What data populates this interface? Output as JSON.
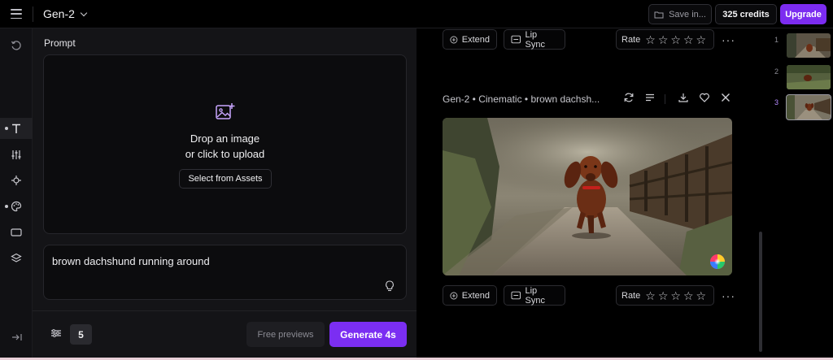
{
  "header": {
    "model": "Gen-2",
    "save_label": "Save in...",
    "credits_label": "325 credits",
    "upgrade_label": "Upgrade"
  },
  "prompt": {
    "label": "Prompt",
    "drop_line1": "Drop an image",
    "drop_line2": "or click to upload",
    "assets_button": "Select from Assets",
    "text": "brown dachshund running around"
  },
  "footer": {
    "count": "5",
    "free_previews": "Free previews",
    "generate": "Generate 4s"
  },
  "output": {
    "extend_label": "Extend",
    "lipsync_label": "Lip Sync",
    "rate_label": "Rate",
    "more_label": "···",
    "generation_title": "Gen-2 • Cinematic • brown dachsh..."
  },
  "thumbnails": [
    {
      "num": "1"
    },
    {
      "num": "2"
    },
    {
      "num": "3"
    }
  ],
  "colors": {
    "accent": "#7b2ef2",
    "background": "#000000",
    "panel": "#141417"
  }
}
